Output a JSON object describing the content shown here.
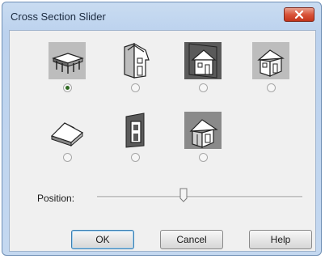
{
  "window": {
    "title": "Cross Section Slider"
  },
  "options": [
    {
      "icon": "slab-cross-section-icon",
      "selected": true
    },
    {
      "icon": "house-wall-section-icon",
      "selected": false
    },
    {
      "icon": "house-dark-section-icon",
      "selected": false
    },
    {
      "icon": "house-outline-icon",
      "selected": false
    },
    {
      "icon": "roof-section-icon",
      "selected": false
    },
    {
      "icon": "wall-frame-section-icon",
      "selected": false
    },
    {
      "icon": "house-perspective-section-icon",
      "selected": false
    }
  ],
  "position": {
    "label": "Position:",
    "value_fraction": 0.4
  },
  "buttons": {
    "ok": "OK",
    "cancel": "Cancel",
    "help": "Help"
  },
  "colors": {
    "close_button": "#d9543a",
    "title_bar": "#c4d8f0",
    "selected_radio": "#2f6a22"
  }
}
